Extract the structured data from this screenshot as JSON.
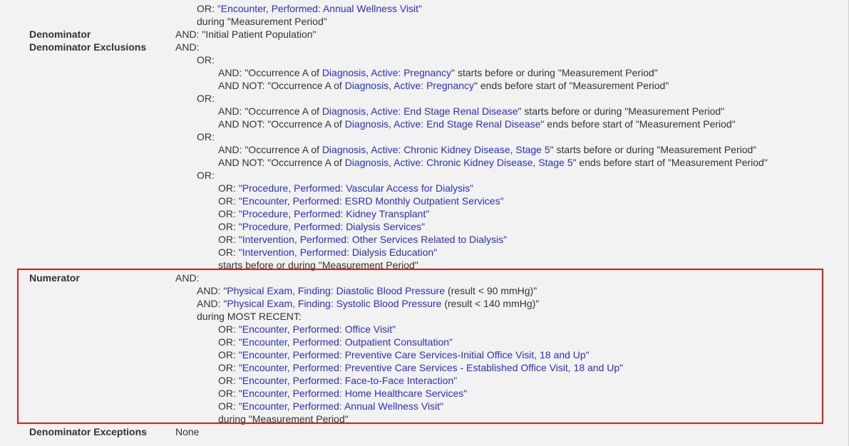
{
  "rows": [
    {
      "label": "",
      "lines": [
        {
          "indent": 1,
          "prefix": "OR: ",
          "link": "\"Encounter, Performed: Annual Wellness Visit\"",
          "suffix": ""
        },
        {
          "indent": 1,
          "prefix": "during \"Measurement Period\"",
          "link": "",
          "suffix": ""
        }
      ]
    },
    {
      "label": "Denominator",
      "lines": [
        {
          "indent": 0,
          "prefix": "AND: \"Initial Patient Population\"",
          "link": "",
          "suffix": ""
        }
      ]
    },
    {
      "label": "Denominator Exclusions",
      "lines": [
        {
          "indent": 0,
          "prefix": "AND:",
          "link": "",
          "suffix": ""
        },
        {
          "indent": 1,
          "prefix": "OR:",
          "link": "",
          "suffix": ""
        },
        {
          "indent": 2,
          "prefix": "AND: \"Occurrence A of ",
          "link": "Diagnosis, Active: Pregnancy",
          "suffix": "\" starts before or during \"Measurement Period\""
        },
        {
          "indent": 2,
          "prefix": "AND NOT: \"Occurrence A of ",
          "link": "Diagnosis, Active: Pregnancy",
          "suffix": "\" ends before start of \"Measurement Period\""
        },
        {
          "indent": 1,
          "prefix": "OR:",
          "link": "",
          "suffix": ""
        },
        {
          "indent": 2,
          "prefix": "AND: \"Occurrence A of ",
          "link": "Diagnosis, Active: End Stage Renal Disease",
          "suffix": "\" starts before or during \"Measurement Period\""
        },
        {
          "indent": 2,
          "prefix": "AND NOT: \"Occurrence A of ",
          "link": "Diagnosis, Active: End Stage Renal Disease",
          "suffix": "\" ends before start of \"Measurement Period\""
        },
        {
          "indent": 1,
          "prefix": "OR:",
          "link": "",
          "suffix": ""
        },
        {
          "indent": 2,
          "prefix": "AND: \"Occurrence A of ",
          "link": "Diagnosis, Active: Chronic Kidney Disease, Stage 5",
          "suffix": "\" starts before or during \"Measurement Period\""
        },
        {
          "indent": 2,
          "prefix": "AND NOT: \"Occurrence A of ",
          "link": "Diagnosis, Active: Chronic Kidney Disease, Stage 5",
          "suffix": "\" ends before start of \"Measurement Period\""
        },
        {
          "indent": 1,
          "prefix": "OR:",
          "link": "",
          "suffix": ""
        },
        {
          "indent": 2,
          "prefix": "OR: ",
          "link": "\"Procedure, Performed: Vascular Access for Dialysis\"",
          "suffix": ""
        },
        {
          "indent": 2,
          "prefix": "OR: ",
          "link": "\"Encounter, Performed: ESRD Monthly Outpatient Services\"",
          "suffix": ""
        },
        {
          "indent": 2,
          "prefix": "OR: ",
          "link": "\"Procedure, Performed: Kidney Transplant\"",
          "suffix": ""
        },
        {
          "indent": 2,
          "prefix": "OR: ",
          "link": "\"Procedure, Performed: Dialysis Services\"",
          "suffix": ""
        },
        {
          "indent": 2,
          "prefix": "OR: ",
          "link": "\"Intervention, Performed: Other Services Related to Dialysis\"",
          "suffix": ""
        },
        {
          "indent": 2,
          "prefix": "OR: ",
          "link": "\"Intervention, Performed: Dialysis Education\"",
          "suffix": ""
        },
        {
          "indent": 2,
          "prefix": "starts before or during \"Measurement Period\"",
          "link": "",
          "suffix": ""
        }
      ]
    },
    {
      "label": "Numerator",
      "lines": [
        {
          "indent": 0,
          "prefix": "AND:",
          "link": "",
          "suffix": ""
        },
        {
          "indent": 1,
          "prefix": "AND: \"",
          "link": "Physical Exam, Finding: Diastolic Blood Pressure",
          "suffix": " (result < 90 mmHg)\""
        },
        {
          "indent": 1,
          "prefix": "AND: \"",
          "link": "Physical Exam, Finding: Systolic Blood Pressure",
          "suffix": " (result < 140 mmHg)\""
        },
        {
          "indent": 1,
          "prefix": "during MOST RECENT:",
          "link": "",
          "suffix": ""
        },
        {
          "indent": 2,
          "prefix": "OR: ",
          "link": "\"Encounter, Performed: Office Visit\"",
          "suffix": ""
        },
        {
          "indent": 2,
          "prefix": "OR: ",
          "link": "\"Encounter, Performed: Outpatient Consultation\"",
          "suffix": ""
        },
        {
          "indent": 2,
          "prefix": "OR: ",
          "link": "\"Encounter, Performed: Preventive Care Services-Initial Office Visit, 18 and Up\"",
          "suffix": ""
        },
        {
          "indent": 2,
          "prefix": "OR: ",
          "link": "\"Encounter, Performed: Preventive Care Services - Established Office Visit, 18 and Up\"",
          "suffix": ""
        },
        {
          "indent": 2,
          "prefix": "OR: ",
          "link": "\"Encounter, Performed: Face-to-Face Interaction\"",
          "suffix": ""
        },
        {
          "indent": 2,
          "prefix": "OR: ",
          "link": "\"Encounter, Performed: Home Healthcare Services\"",
          "suffix": ""
        },
        {
          "indent": 2,
          "prefix": "OR: ",
          "link": "\"Encounter, Performed: Annual Wellness Visit\"",
          "suffix": ""
        },
        {
          "indent": 2,
          "prefix": "during \"Measurement Period\"",
          "link": "",
          "suffix": ""
        }
      ]
    },
    {
      "label": "Denominator Exceptions",
      "lines": [
        {
          "indent": 0,
          "prefix": "None",
          "link": "",
          "suffix": ""
        }
      ]
    }
  ]
}
